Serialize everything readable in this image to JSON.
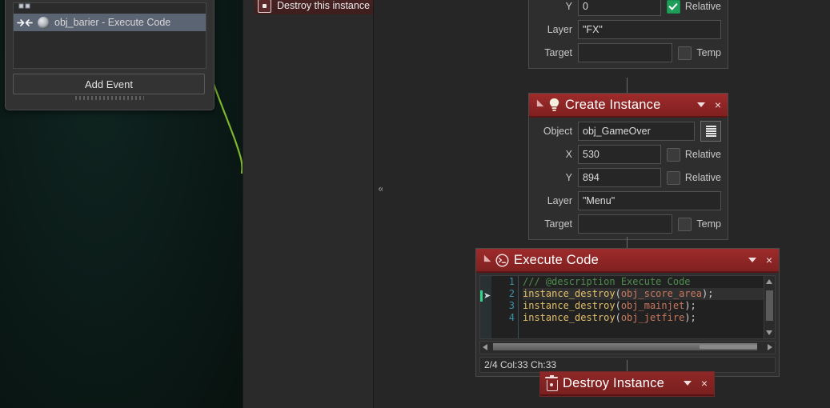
{
  "app": {
    "theme_accent": "#9e2b2b",
    "background": "#262626",
    "left_panel_background": "#0c1c19",
    "annotation_color": "#ee1b13"
  },
  "event_panel": {
    "partial_row_label": "",
    "rows": [
      {
        "label": "obj_barier - Execute Code",
        "selected": true,
        "event_icon": "collision-event-icon",
        "sprite_icon": "object-sprite-icon"
      }
    ],
    "add_event_label": "Add Event",
    "resize_grip": "resize-grip"
  },
  "action_library": {
    "destroy_this_instance": {
      "label": "Destroy this instance",
      "icon": "destroy-instance-icon"
    }
  },
  "divider": {
    "collapse_glyph": "«"
  },
  "blocks": [
    {
      "id": "partial-top-block",
      "title": "",
      "fields": [
        {
          "label": "Y",
          "value": "0",
          "checkbox_label": "Relative",
          "checked": true
        },
        {
          "label": "Layer",
          "value": "\"FX\"",
          "checkbox_label": "",
          "checked": false
        },
        {
          "label": "Target",
          "value": "",
          "checkbox_label": "Temp",
          "checked": false
        }
      ]
    },
    {
      "id": "create-instance",
      "title": "Create Instance",
      "icon": "lightbulb-icon",
      "caret": "chevron-down-icon",
      "close": "×",
      "fields": [
        {
          "label": "Object",
          "value": "obj_GameOver",
          "picker": "list-picker-icon"
        },
        {
          "label": "X",
          "value": "530",
          "checkbox_label": "Relative",
          "checked": false
        },
        {
          "label": "Y",
          "value": "894",
          "checkbox_label": "Relative",
          "checked": false
        },
        {
          "label": "Layer",
          "value": "\"Menu\"",
          "checkbox_label": "",
          "checked": false
        },
        {
          "label": "Target",
          "value": "",
          "checkbox_label": "Temp",
          "checked": false
        }
      ]
    },
    {
      "id": "execute-code",
      "title": "Execute Code",
      "icon": "code-circle-icon",
      "caret": "chevron-down-icon",
      "close": "×",
      "code": {
        "lines": [
          {
            "num": "1",
            "type": "comment",
            "text": "/// @description Execute Code",
            "active": false
          },
          {
            "num": "2",
            "type": "call",
            "fn": "instance_destroy",
            "arg": "obj_score_area",
            "active": true
          },
          {
            "num": "3",
            "type": "call",
            "fn": "instance_destroy",
            "arg": "obj_mainjet",
            "active": false
          },
          {
            "num": "4",
            "type": "call",
            "fn": "instance_destroy",
            "arg": "obj_jetfire",
            "active": false
          }
        ],
        "status": "2/4 Col:33 Ch:33",
        "colors": {
          "comment": "#4e8d4e",
          "function": "#e3c06b",
          "argument": "#c9785e",
          "punctuation": "#cfcfcf",
          "line_number": "#3d8fa8"
        }
      }
    },
    {
      "id": "destroy-instance",
      "title": "Destroy Instance",
      "icon": "trash-icon",
      "caret": "chevron-down-icon",
      "close": "×"
    }
  ]
}
